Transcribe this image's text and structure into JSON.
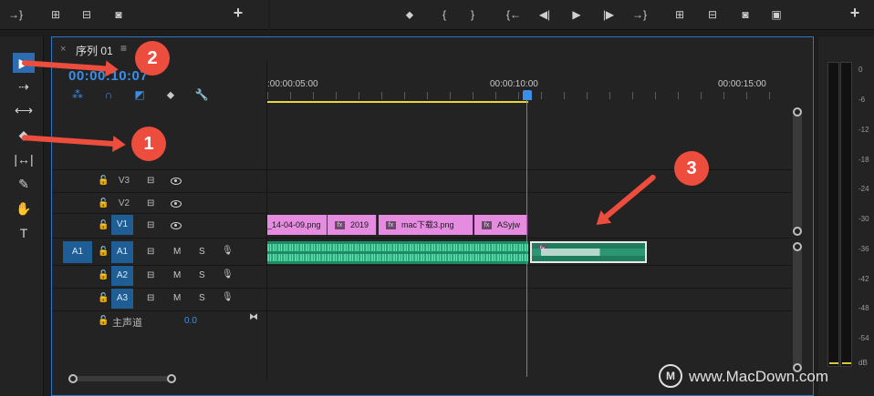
{
  "toolbar_left": {
    "icons": [
      "mark-out-icon",
      "lift-icon",
      "extract-icon",
      "camera-icon"
    ],
    "add_label": "+"
  },
  "toolbar_right": {
    "icons": [
      "marker-icon",
      "mark-in-icon",
      "mark-out-icon",
      "go-to-in-icon",
      "step-back-icon",
      "play-icon",
      "step-forward-icon",
      "go-to-out-icon",
      "insert-icon",
      "overwrite-icon",
      "export-frame-icon",
      "compare-icon"
    ],
    "add_label": "+"
  },
  "tools": [
    "selection-tool",
    "track-select-tool",
    "ripple-edit-tool",
    "razor-tool",
    "slip-tool",
    "pen-tool",
    "hand-tool",
    "type-tool"
  ],
  "panel": {
    "tab_close": "×",
    "tab_title": "序列 01",
    "tab_menu": "≡",
    "timecode": "00:00:10:07"
  },
  "ruler": {
    "labels": [
      ":00:00:05:00",
      "00:00:10:00",
      "00:00:15:00"
    ]
  },
  "tracks": {
    "video": [
      {
        "name": "V3",
        "target": false
      },
      {
        "name": "V2",
        "target": false
      },
      {
        "name": "V1",
        "target": true
      }
    ],
    "audio": [
      {
        "name": "A1",
        "target": true,
        "mute": "M",
        "solo": "S"
      },
      {
        "name": "A2",
        "target": true,
        "mute": "M",
        "solo": "S"
      },
      {
        "name": "A3",
        "target": true,
        "mute": "M",
        "solo": "S"
      }
    ],
    "source_patch": "A1",
    "master_label": "主声道",
    "master_value": "0.0"
  },
  "clips": {
    "video": [
      {
        "label": "_14-04-09.png",
        "fx": false
      },
      {
        "label": "2019",
        "fx": true
      },
      {
        "label": "mac下载3.png",
        "fx": true
      },
      {
        "label": "ASyjw",
        "fx": true
      }
    ],
    "fx_label": "fx"
  },
  "meter": {
    "labels": [
      "0",
      "-6",
      "-12",
      "-18",
      "-24",
      "-30",
      "-36",
      "-42",
      "-48",
      "-54",
      "dB"
    ]
  },
  "annotations": [
    "1",
    "2",
    "3"
  ],
  "watermark": {
    "logo": "M",
    "text": "www.MacDown.com"
  },
  "colors": {
    "accent": "#3b8ee8",
    "video_clip": "#e58be0",
    "audio_clip": "#1f8a66",
    "annotation": "#ec4d3d"
  }
}
